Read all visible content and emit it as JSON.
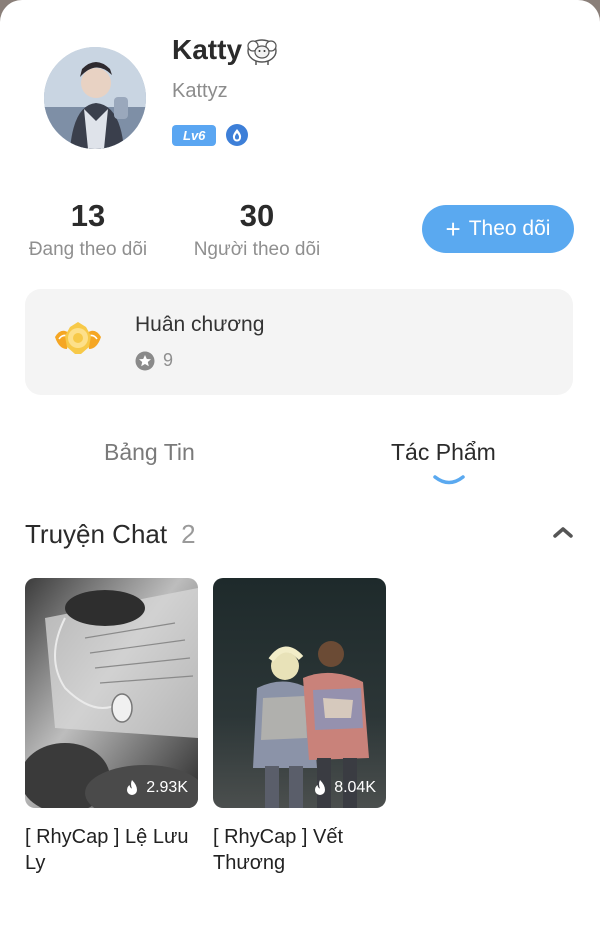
{
  "profile": {
    "display_name": "Katty",
    "username": "Kattyz",
    "level": "Lv6"
  },
  "stats": {
    "following_count": "13",
    "following_label": "Đang theo dõi",
    "followers_count": "30",
    "followers_label": "Người theo dõi"
  },
  "follow_button": {
    "label": "Theo dõi",
    "color": "#5aa9f0"
  },
  "medals": {
    "title": "Huân chương",
    "count": "9"
  },
  "tabs": [
    {
      "label": "Bảng Tin",
      "active": false
    },
    {
      "label": "Tác Phẩm",
      "active": true
    }
  ],
  "section": {
    "title": "Truyện Chat",
    "count": "2"
  },
  "stories": [
    {
      "title": "[ RhyCap ] Lệ Lưu Ly",
      "views": "2.93K"
    },
    {
      "title": "[ RhyCap ] Vết Thương",
      "views": "8.04K"
    }
  ],
  "icons": {
    "sheep": "sheep-icon",
    "drop": "drop-badge-icon",
    "medal": "medal-icon",
    "star": "star-icon",
    "collapse": "chevron-up-icon",
    "fire": "fire-icon"
  },
  "colors": {
    "accent": "#5aa9f0",
    "card_bg": "#f4f4f4"
  }
}
